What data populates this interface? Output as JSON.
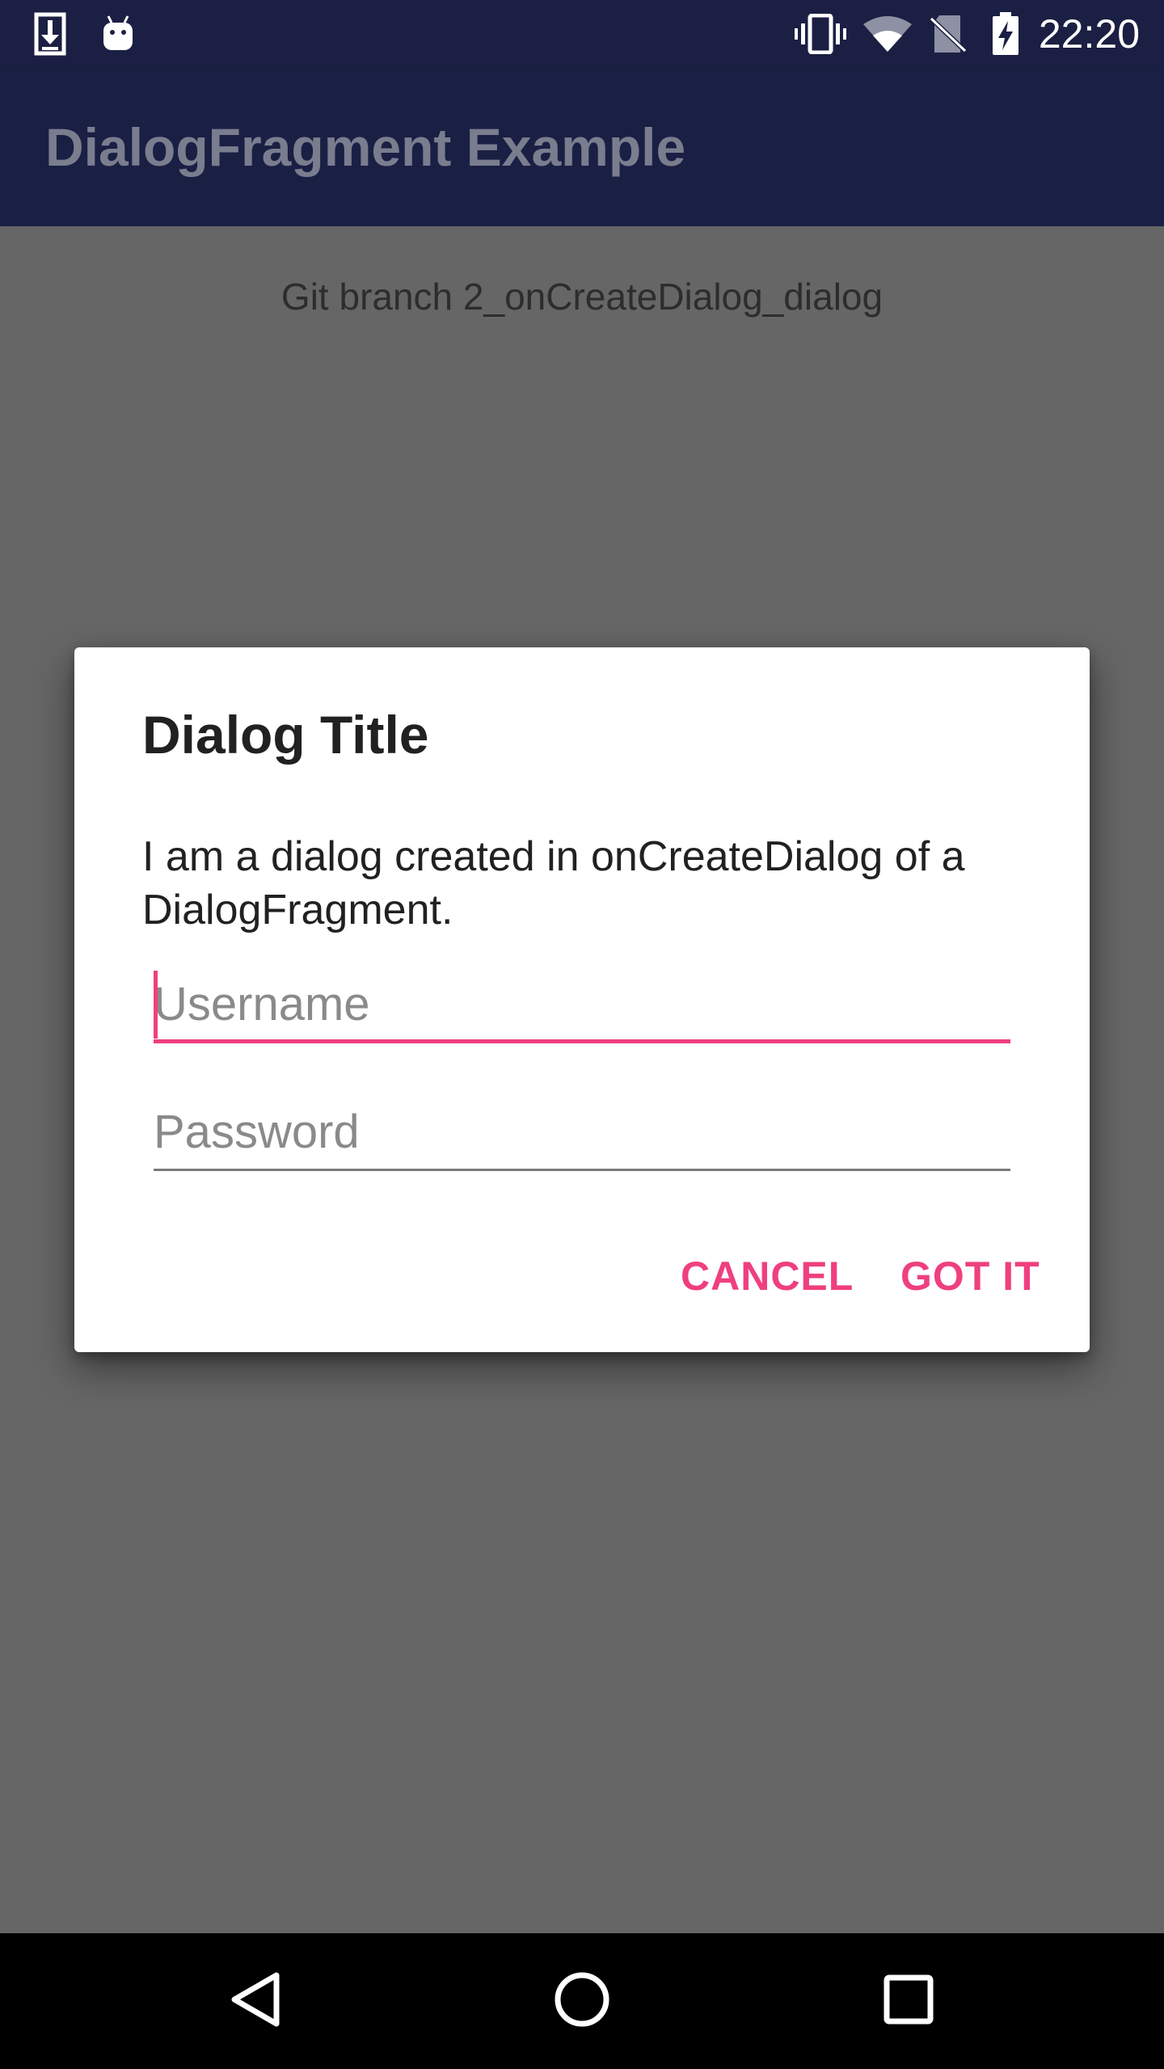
{
  "status_bar": {
    "time": "22:20",
    "icons": [
      "download-notification-icon",
      "android-notification-icon",
      "vibrate-icon",
      "wifi-icon",
      "no-sim-icon",
      "battery-charging-icon"
    ]
  },
  "app_bar": {
    "title": "DialogFragment Example"
  },
  "main": {
    "branch_text": "Git branch 2_onCreateDialog_dialog"
  },
  "dialog": {
    "title": "Dialog Title",
    "message": "I am a dialog created in onCreateDialog of a DialogFragment.",
    "username_placeholder": "Username",
    "username_value": "",
    "password_placeholder": "Password",
    "password_value": "",
    "cancel_label": "CANCEL",
    "ok_label": "GOT IT"
  },
  "nav_bar": {
    "icons": [
      "back-icon",
      "home-icon",
      "recents-icon"
    ]
  },
  "colors": {
    "accent": "#ef3f7f",
    "primary_dark": "#1b1f43",
    "scrim_background": "#666666"
  }
}
